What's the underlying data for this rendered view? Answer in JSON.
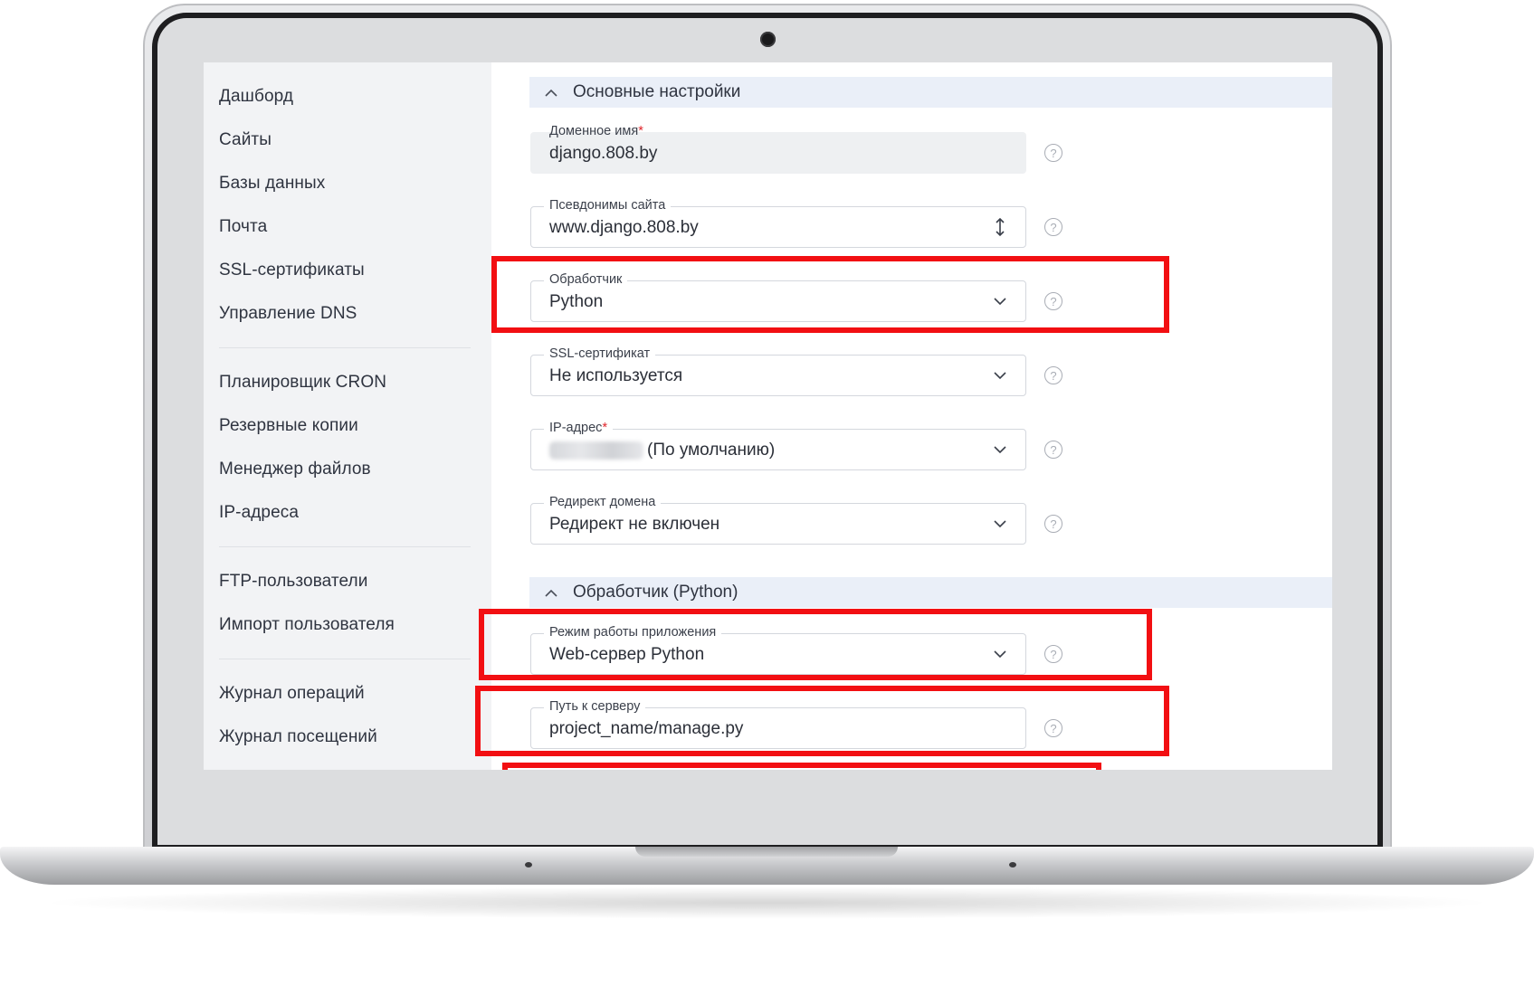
{
  "sidebar": {
    "items": [
      "Дашборд",
      "Сайты",
      "Базы данных",
      "Почта",
      "SSL-сертификаты",
      "Управление DNS",
      "Планировщик CRON",
      "Резервные копии",
      "Менеджер файлов",
      "IP-адреса",
      "FTP-пользователи",
      "Импорт пользователя",
      "Журнал операций",
      "Журнал посещений"
    ]
  },
  "sections": {
    "main_title": "Основные настройки",
    "handler_title": "Обработчик (Python)"
  },
  "fields": {
    "domain": {
      "label": "Доменное имя",
      "required": "*",
      "value": "django.808.by"
    },
    "aliases": {
      "label": "Псевдонимы сайта",
      "value": "www.django.808.by"
    },
    "handler": {
      "label": "Обработчик",
      "value": "Python"
    },
    "ssl": {
      "label": "SSL-сертификат",
      "value": "Не используется"
    },
    "ip": {
      "label": "IP-адрес",
      "required": "*",
      "value": "(По умолчанию)"
    },
    "redirect": {
      "label": "Редирект домена",
      "value": "Редирект не включен"
    },
    "app_mode": {
      "label": "Режим работы приложения",
      "value": "Web-сервер Python"
    },
    "server_path": {
      "label": "Путь к серверу",
      "value": "project_name/manage.py"
    }
  },
  "help_glyph": "?",
  "colors": {
    "highlight": "#f20f12",
    "section_bg": "#eaeff8",
    "sidebar_bg": "#f2f3f5"
  },
  "icons": {
    "collapse": "chevron-up-icon",
    "dropdown": "chevron-down-icon",
    "resize": "resize-vertical-icon",
    "help": "help-circle-icon"
  }
}
